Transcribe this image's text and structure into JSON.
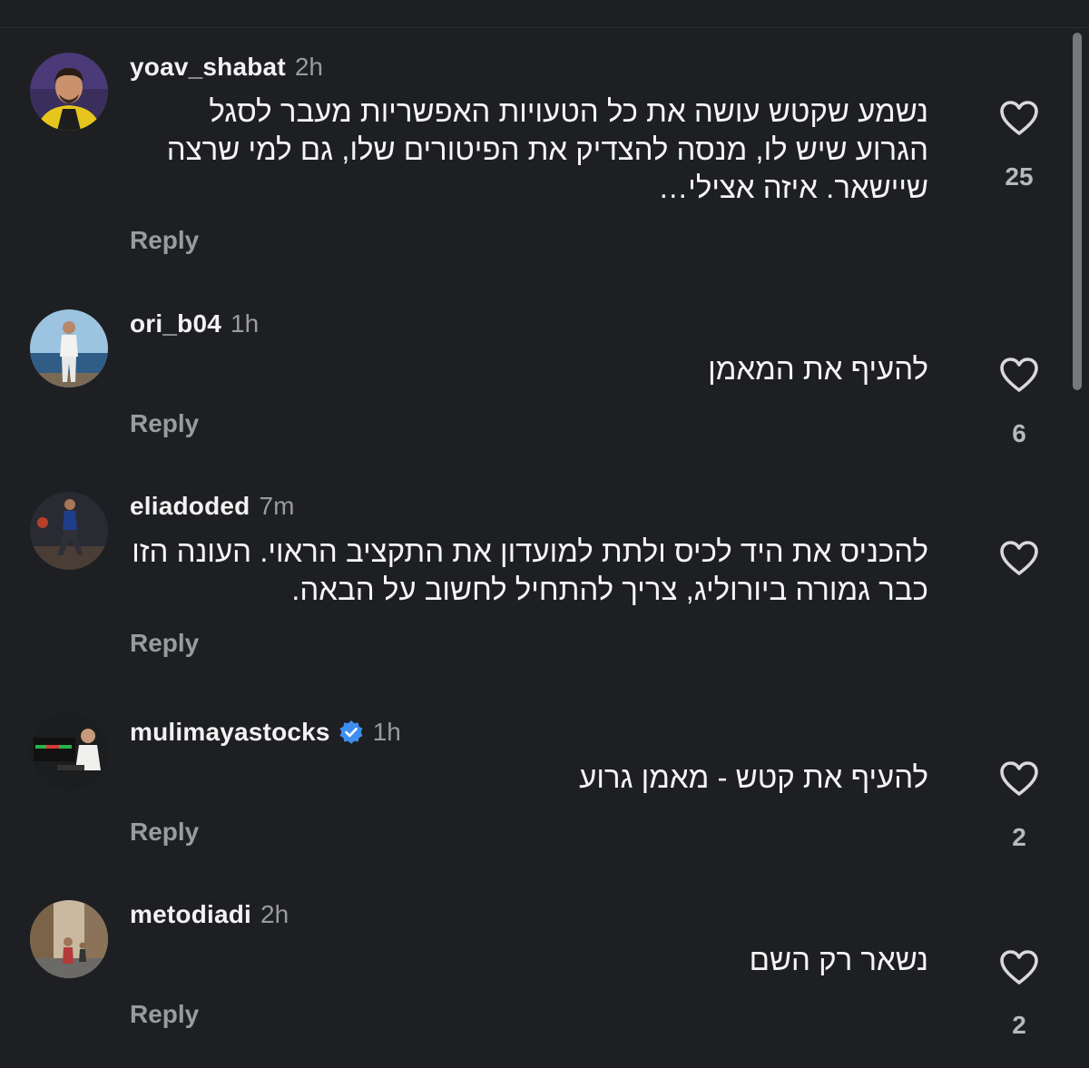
{
  "colors": {
    "background": "#1e1f23",
    "text": "#f2f2f2",
    "muted": "#9a9ba0",
    "verified": "#3d8ef0"
  },
  "comments": [
    {
      "username": "yoav_shabat",
      "time": "2h",
      "verified": false,
      "text": "נשמע שקטש עושה את כל הטעויות האפשריות מעבר לסגל הגרוע שיש לו, מנסה להצדיק את הפיטורים שלו, גם למי שרצה שיישאר.  איזה אצילי…",
      "reply_label": "Reply",
      "likes": "25",
      "like_icon": "heart-outline-icon"
    },
    {
      "username": "ori_b04",
      "time": "1h",
      "verified": false,
      "text": "להעיף את המאמן",
      "reply_label": "Reply",
      "likes": "6",
      "like_icon": "heart-outline-icon"
    },
    {
      "username": "eliadoded",
      "time": "7m",
      "verified": false,
      "text": "להכניס את היד לכיס ולתת למועדון את התקציב הראוי. העונה הזו כבר גמורה ביורוליג, צריך להתחיל לחשוב על הבאה.",
      "reply_label": "Reply",
      "likes": "",
      "like_icon": "heart-outline-icon"
    },
    {
      "username": "mulimayastocks",
      "time": "1h",
      "verified": true,
      "verified_icon": "verified-badge-icon",
      "text": "להעיף את קטש - מאמן גרוע",
      "reply_label": "Reply",
      "likes": "2",
      "like_icon": "heart-outline-icon"
    },
    {
      "username": "metodiadi",
      "time": "2h",
      "verified": false,
      "text": "נשאר רק השם",
      "reply_label": "Reply",
      "likes": "2",
      "like_icon": "heart-outline-icon"
    }
  ]
}
